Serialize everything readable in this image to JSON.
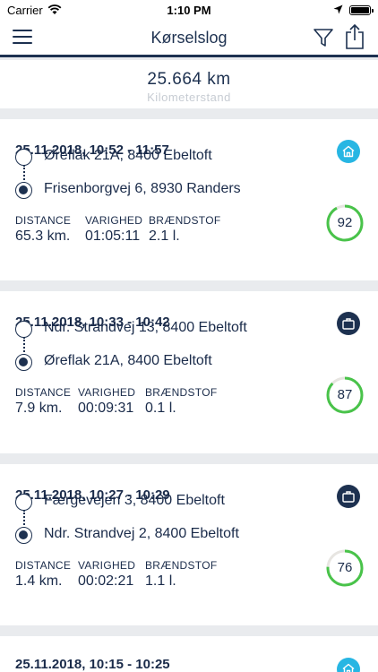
{
  "status_bar": {
    "carrier": "Carrier",
    "time": "1:10 PM"
  },
  "nav": {
    "title": "Kørselslog"
  },
  "odometer": {
    "value": "25.664 km",
    "label": "Kilometerstand"
  },
  "stat_labels": {
    "distance": "DISTANCE",
    "duration": "VARIGHED",
    "fuel": "BRÆNDSTOF"
  },
  "trips": [
    {
      "date": "25.11.2018, 10:52 - 11:57",
      "from": "Øreflak 21A, 8400 Ebeltoft",
      "to": "Frisenborgvej 6, 8930 Randers",
      "distance": "65.3 km.",
      "duration": "01:05:11",
      "fuel": "2.1 l.",
      "score": "92",
      "score_fraction": 0.92,
      "category_icon": "home-icon",
      "category_color": "#27b6e3"
    },
    {
      "date": "25.11.2018, 10:33 - 10:42",
      "from": "Ndr. Strandvej 13, 8400 Ebeltoft",
      "to": "Øreflak 21A, 8400 Ebeltoft",
      "distance": "7.9 km.",
      "duration": "00:09:31",
      "fuel": "0.1 l.",
      "score": "87",
      "score_fraction": 0.87,
      "category_icon": "briefcase-icon",
      "category_color": "#1d3150"
    },
    {
      "date": "25.11.2018, 10:27 - 10:29",
      "from": "Færgevejen 3, 8400 Ebeltoft",
      "to": "Ndr. Strandvej 2, 8400 Ebeltoft",
      "distance": "1.4 km.",
      "duration": "00:02:21",
      "fuel": "1.1 l.",
      "score": "76",
      "score_fraction": 0.76,
      "category_icon": "briefcase-icon",
      "category_color": "#1d3150"
    },
    {
      "date": "25.11.2018, 10:15 - 10:25",
      "category_icon": "home-icon",
      "category_color": "#27b6e3"
    }
  ],
  "colors": {
    "navy": "#1d3150",
    "accent": "#27b6e3",
    "score_green": "#49c34a",
    "score_track": "#e7e5e1"
  }
}
